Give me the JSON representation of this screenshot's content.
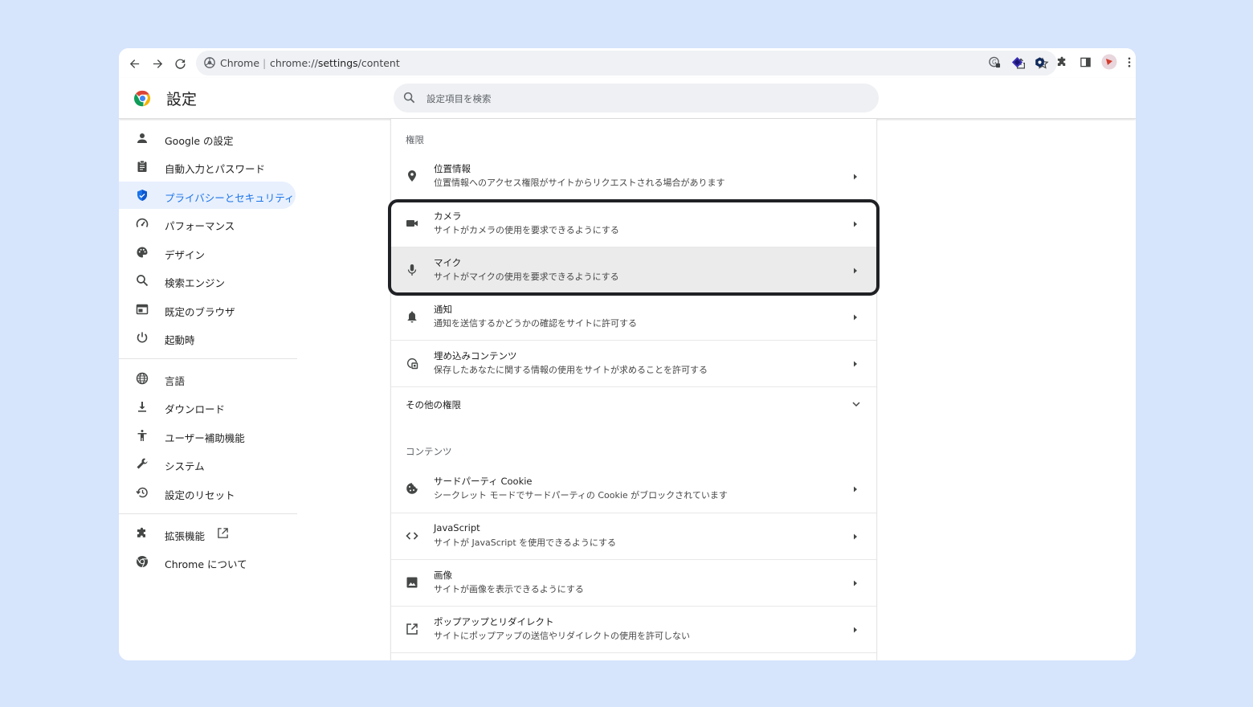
{
  "browser": {
    "site_name": "Chrome",
    "separator": "|",
    "url_prefix": "chrome://",
    "url_bold": "settings",
    "url_suffix": "/content",
    "icons": [
      "back-icon",
      "forward-icon",
      "reload-icon",
      "share-icon",
      "bookmark-star-icon",
      "extension-1-icon",
      "extension-2-icon",
      "extension-3-icon",
      "puzzle-icon",
      "side-panel-icon",
      "profile-avatar",
      "more-menu-icon"
    ]
  },
  "header": {
    "title": "設定",
    "search_placeholder": "設定項目を検索"
  },
  "sidebar": {
    "items": [
      {
        "label": "Google の設定",
        "icon": "person-icon"
      },
      {
        "label": "自動入力とパスワード",
        "icon": "clipboard-icon"
      },
      {
        "label": "プライバシーとセキュリティ",
        "icon": "shield-icon",
        "active": true
      },
      {
        "label": "パフォーマンス",
        "icon": "speedometer-icon"
      },
      {
        "label": "デザイン",
        "icon": "palette-icon"
      },
      {
        "label": "検索エンジン",
        "icon": "search-icon"
      },
      {
        "label": "既定のブラウザ",
        "icon": "browser-icon"
      },
      {
        "label": "起動時",
        "icon": "power-icon"
      },
      {
        "label": "言語",
        "icon": "globe-icon"
      },
      {
        "label": "ダウンロード",
        "icon": "download-icon"
      },
      {
        "label": "ユーザー補助機能",
        "icon": "accessibility-icon"
      },
      {
        "label": "システム",
        "icon": "wrench-icon"
      },
      {
        "label": "設定のリセット",
        "icon": "history-icon"
      },
      {
        "label": "拡張機能",
        "icon": "puzzle-icon"
      },
      {
        "label": "Chrome について",
        "icon": "chrome-icon"
      }
    ]
  },
  "permissions": {
    "section_label": "権限",
    "rows": [
      {
        "title": "位置情報",
        "desc": "位置情報へのアクセス権限がサイトからリクエストされる場合があります",
        "icon": "location-pin-icon"
      },
      {
        "title": "カメラ",
        "desc": "サイトがカメラの使用を要求できるようにする",
        "icon": "camera-icon"
      },
      {
        "title": "マイク",
        "desc": "サイトがマイクの使用を要求できるようにする",
        "icon": "microphone-icon"
      },
      {
        "title": "通知",
        "desc": "通知を送信するかどうかの確認をサイトに許可する",
        "icon": "bell-icon"
      },
      {
        "title": "埋め込みコンテンツ",
        "desc": "保存したあなたに関する情報の使用をサイトが求めることを許可する",
        "icon": "embedded-content-icon"
      }
    ],
    "more_label": "その他の権限"
  },
  "content": {
    "section_label": "コンテンツ",
    "rows": [
      {
        "title": "サードパーティ Cookie",
        "desc": "シークレット モードでサードパーティの Cookie がブロックされています",
        "icon": "cookie-icon"
      },
      {
        "title": "JavaScript",
        "desc": "サイトが JavaScript を使用できるようにする",
        "icon": "code-icon"
      },
      {
        "title": "画像",
        "desc": "サイトが画像を表示できるようにする",
        "icon": "image-icon"
      },
      {
        "title": "ポップアップとリダイレクト",
        "desc": "サイトにポップアップの送信やリダイレクトの使用を許可しない",
        "icon": "popup-icon"
      }
    ]
  },
  "colors": {
    "accent": "#1a73e8",
    "active_bg": "#e8f0fe",
    "page_bg": "#d6e4fc"
  }
}
